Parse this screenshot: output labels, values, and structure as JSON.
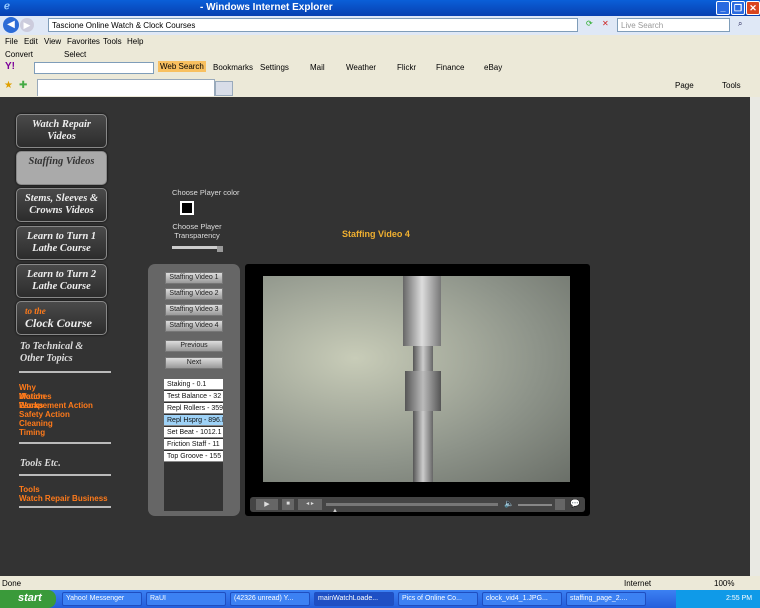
{
  "window": {
    "title": "- Windows Internet Explorer"
  },
  "address": {
    "url": "Tascione Online Watch & Clock Courses",
    "search_placeholder": "Live Search"
  },
  "menu": [
    "File",
    "Edit",
    "View",
    "Favorites",
    "Tools",
    "Help"
  ],
  "convert_bar": {
    "convert": "Convert",
    "select": "Select"
  },
  "yahoo_bar": {
    "logo": "Y!",
    "web_search": "Web Search",
    "items": [
      "Bookmarks",
      "Settings",
      "Mail",
      "Weather",
      "Flickr",
      "Finance",
      "eBay"
    ]
  },
  "command_bar": {
    "page": "Page",
    "tools": "Tools"
  },
  "sidebar": {
    "nav": [
      "Watch Repair Videos",
      "Staffing Videos",
      "Stems, Sleeves & Crowns Videos",
      "Learn to Turn 1 Lathe Course",
      "Learn to Turn 2 Lathe Course"
    ],
    "clock_pre": "to the",
    "clock": "Clock Course",
    "technical": "To Technical & Other Topics",
    "links1": [
      "Why Watches Work",
      "Motion Works",
      "Escapement Action",
      "Safety Action",
      "Cleaning",
      "Timing"
    ],
    "tools_heading": "Tools Etc.",
    "links2": [
      "Tools",
      "Watch Repair Business"
    ]
  },
  "player": {
    "color_label": "Choose Player color",
    "transparency_label": "Choose Player Transparency",
    "title": "Staffing Video 4",
    "videos": [
      "Staffing Video 1",
      "Staffing Video 2",
      "Staffing Video 3",
      "Staffing Video 4"
    ],
    "previous": "Previous",
    "next": "Next",
    "chapters": [
      "Staking - 0.1",
      "Test Balance - 32",
      "Repl Rollers - 359",
      "Repl Hsprg - 896.I",
      "Set Beat - 1012.1",
      "Friction Staff - 11",
      "Top Groove - 155"
    ],
    "selected_chapter": 3,
    "title_color": "#f0b030"
  },
  "status": {
    "text": "Done",
    "zone": "Internet",
    "zoom": "100%"
  },
  "taskbar": {
    "start": "start",
    "tasks": [
      "Yahoo! Messenger",
      "RaUI",
      "(42326 unread) Y...",
      "mainWatchLoade...",
      "Pics of Online Co...",
      "clock_vid4_1.JPG...",
      "staffing_page_2...."
    ],
    "clock": "2:55 PM"
  }
}
